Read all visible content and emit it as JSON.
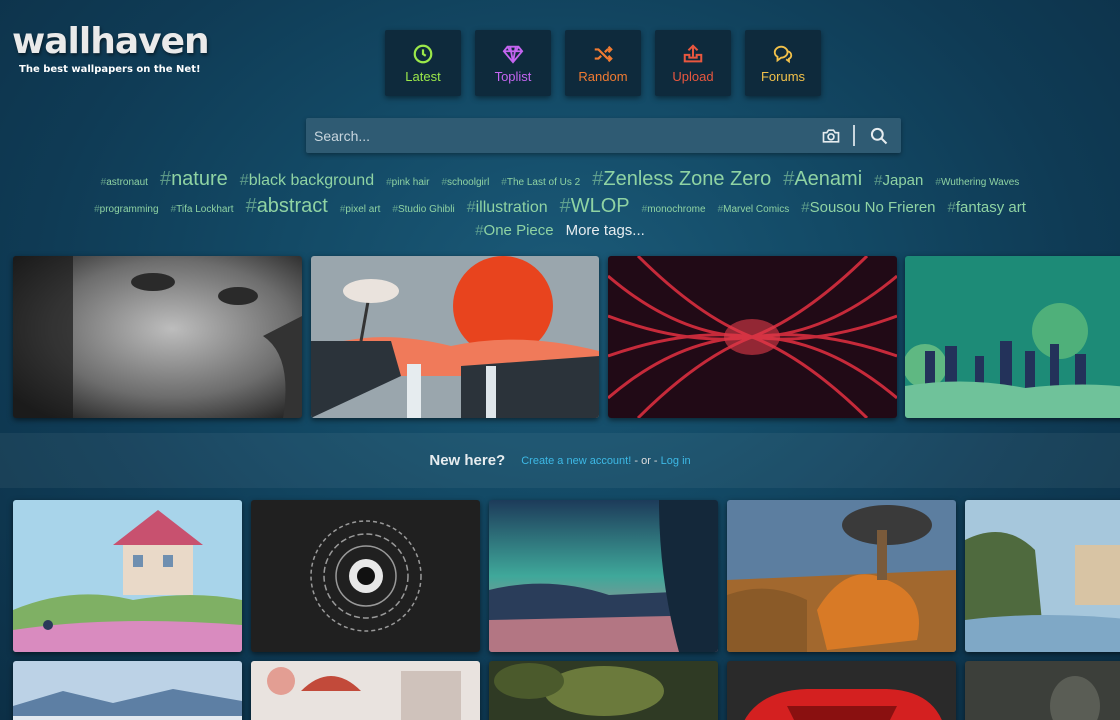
{
  "logo": {
    "text": "wallhaven",
    "tagline": "The best wallpapers on the Net!"
  },
  "nav": [
    {
      "label": "Latest",
      "icon": "clock-icon",
      "color": "#9be84a"
    },
    {
      "label": "Toplist",
      "icon": "diamond-icon",
      "color": "#c465f0"
    },
    {
      "label": "Random",
      "icon": "shuffle-icon",
      "color": "#f07b32"
    },
    {
      "label": "Upload",
      "icon": "upload-icon",
      "color": "#e8573f"
    },
    {
      "label": "Forums",
      "icon": "chat-icon",
      "color": "#f2c14a"
    }
  ],
  "search": {
    "placeholder": "Search..."
  },
  "tags": {
    "row1": [
      "astronaut",
      "nature",
      "black background",
      "pink hair",
      "schoolgirl",
      "The Last of Us 2",
      "Zenless Zone Zero",
      "Aenami",
      "Japan",
      "Wuthering Waves"
    ],
    "row2": [
      "programming",
      "Tifa Lockhart",
      "abstract",
      "pixel art",
      "Studio Ghibli",
      "illustration",
      "WLOP",
      "monochrome",
      "Marvel Comics",
      "Sousou No Frieren",
      "fantasy art"
    ],
    "row3": [
      "One Piece"
    ],
    "more": "More tags..."
  },
  "newhere": {
    "title": "New here?",
    "create": "Create a new account!",
    "or": "- or -",
    "login": "Log in"
  },
  "colors": {
    "accent_tag": "#8fd3a3",
    "link": "#3db9e6",
    "nav_bg": "#0e2a3c"
  }
}
